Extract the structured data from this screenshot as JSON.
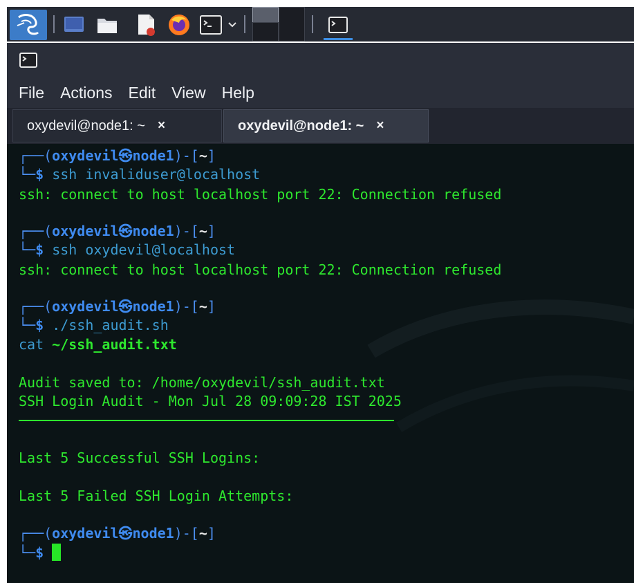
{
  "colors": {
    "panel_bg": "#262a33",
    "kali_blue": "#3c7cc8",
    "terminal_bg": "#0b1416",
    "prompt_blue": "#4b8eef",
    "output_green": "#2ee82e",
    "cmd_cyan": "#3d9bd1"
  },
  "panel": {
    "launchers": [
      "kali-menu-icon",
      "desktop-icon",
      "file-manager-icon",
      "text-editor-icon",
      "firefox-icon",
      "terminal-icon",
      "chevron-down-icon",
      "workspace-1",
      "workspace-2",
      "terminal-task-icon"
    ]
  },
  "window": {
    "title_icon": "terminal-icon",
    "menu": [
      "File",
      "Actions",
      "Edit",
      "View",
      "Help"
    ],
    "tabs": [
      {
        "label": "oxydevil@node1: ~",
        "close": "×",
        "active": false
      },
      {
        "label": "oxydevil@node1: ~",
        "close": "×",
        "active": true
      }
    ]
  },
  "terminal": {
    "prompt": {
      "open": "┌──(",
      "user": "oxydevil",
      "at": "㉿",
      "host": "node1",
      "mid": ")-[",
      "dir": "~",
      "close": "]",
      "arrow": "└─",
      "dollar": "$"
    },
    "cmd1": "ssh invaliduser@localhost",
    "out1": "ssh: connect to host localhost port 22: Connection refused",
    "cmd2": "ssh oxydevil@localhost",
    "out2": "ssh: connect to host localhost port 22: Connection refused",
    "cmd3": "./ssh_audit.sh",
    "cmd3b_word": "cat",
    "cmd3b_arg": "~/ssh_audit.txt",
    "audit_saved": "Audit saved to: /home/oxydevil/ssh_audit.txt",
    "audit_header": "SSH Login Audit - Mon Jul 28 09:09:28 IST 2025",
    "last_success": "Last 5 Successful SSH Logins:",
    "last_failed": "Last 5 Failed SSH Login Attempts:"
  }
}
